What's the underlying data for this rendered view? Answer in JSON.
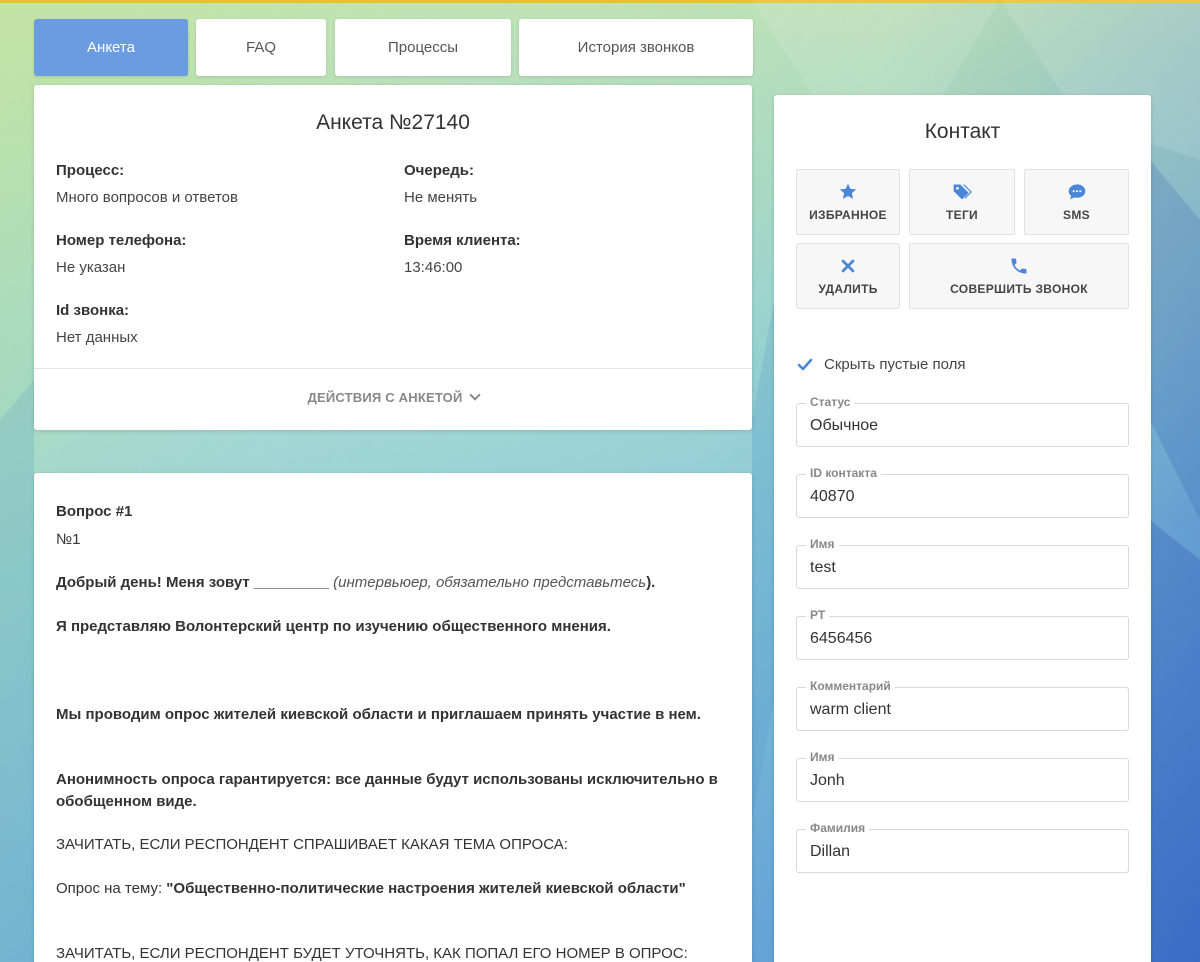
{
  "tabs": [
    {
      "label": "Анкета"
    },
    {
      "label": "FAQ"
    },
    {
      "label": "Процессы"
    },
    {
      "label": "История звонков"
    }
  ],
  "anketa": {
    "title": "Анкета №27140",
    "fields": [
      {
        "label": "Процесс:",
        "value": "Много вопросов и ответов"
      },
      {
        "label": "Очередь:",
        "value": "Не менять"
      },
      {
        "label": "Номер телефона:",
        "value": "Не указан"
      },
      {
        "label": "Время клиента:",
        "value": "13:46:00"
      },
      {
        "label": "Id звонка:",
        "value": "Нет данных"
      }
    ],
    "actions_label": "ДЕЙСТВИЯ С АНКЕТОЙ"
  },
  "question": {
    "heading": "Вопрос #1",
    "number": "№1",
    "greeting_bold": "Добрый день! Меня зовут _________",
    "greeting_italic": "(интервьюер, обязательно представьтесь",
    "greeting_end": ").",
    "intro": "Я представляю Волонтерский центр по изучению общественного мнения.",
    "survey": "Мы проводим опрос жителей киевской области и приглашаем принять участие в нем.",
    "anonymity": "Анонимность опроса гарантируется: все данные будут использованы исключительно в обобщенном виде.",
    "topic_instruction": "ЗАЧИТАТЬ, ЕСЛИ РЕСПОНДЕНТ СПРАШИВАЕТ КАКАЯ ТЕМА ОПРОСА:",
    "topic_prefix": "Опрос на тему: ",
    "topic_value": "\"Общественно-политические настроения жителей киевской области\"",
    "number_instruction": "ЗАЧИТАТЬ, ЕСЛИ РЕСПОНДЕНТ БУДЕТ УТОЧНЯТЬ, КАК ПОПАЛ ЕГО НОМЕР В ОПРОС:"
  },
  "contact": {
    "title": "Контакт",
    "buttons": {
      "favorite": "ИЗБРАННОЕ",
      "tags": "ТЕГИ",
      "sms": "SMS",
      "delete": "УДАЛИТЬ",
      "call": "СОВЕРШИТЬ ЗВОНОК"
    },
    "hide_empty_label": "Скрыть пустые поля",
    "hide_empty_checked": true,
    "fields": [
      {
        "label": "Статус",
        "value": "Обычное"
      },
      {
        "label": "ID контакта",
        "value": "40870"
      },
      {
        "label": "Имя",
        "value": "test"
      },
      {
        "label": "РТ",
        "value": "6456456"
      },
      {
        "label": "Комментарий",
        "value": "warm client"
      },
      {
        "label": "Имя",
        "value": "Jonh"
      },
      {
        "label": "Фамилия",
        "value": "Dillan"
      }
    ]
  },
  "colors": {
    "accent": "#6b9be0",
    "icon": "#4a86d8",
    "delete_icon": "#4a86d8",
    "top_line": "#e7c22a"
  }
}
